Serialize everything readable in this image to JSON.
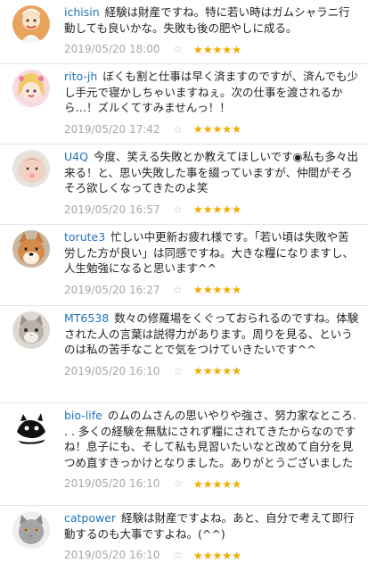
{
  "star_outline_glyph": "☆",
  "stars": "★★★★★",
  "colors": {
    "username": "#1f74bd",
    "date": "#a7a7a7",
    "stars": "#f0ad00",
    "divider": "#e4e4e4"
  },
  "comments": [
    {
      "user": "ichisin",
      "text": "経験は財産ですね。特に若い時はガムシャラニ行動しても良いかな。失敗も後の肥やしに成る。",
      "date": "2019/05/20 18:00"
    },
    {
      "user": "rito-jh",
      "text": "ぼくも割と仕事は早く済ますのですが、済んでも少し手元で寝かしちゃいますねぇ。次の仕事を渡されるから…！ズルくてすみませんっ！！",
      "date": "2019/05/20 17:42"
    },
    {
      "user": "U4Q",
      "text": "今度、笑える失敗とか教えてほしいです◉私も多々出来る！と、思い失敗した事を綴っていますが、仲間がそろそろ欲しくなってきたのよ笑",
      "date": "2019/05/20 16:57"
    },
    {
      "user": "torute3",
      "text": "忙しい中更新お疲れ様です。「若い頃は失敗や苦労した方が良い」は同感ですね。大きな糧になりますし、人生勉強になると思います^^",
      "date": "2019/05/20 16:27"
    },
    {
      "user": "MT6538",
      "text": "数々の修羅場をくぐっておられるのですね。体験された人の言葉は説得力があります。周りを見る、というのは私の苦手なことで気をつけていきたいです^^",
      "date": "2019/05/20 16:10"
    },
    {
      "user": "bio-life",
      "text": "のムのムさんの思いやりや強さ、努力家なところ. . . 多くの経験を無駄にされず糧にされてきたからなのですね！息子にも、そして私も見習いたいなと改めて自分を見つめ直すきっかけとなりました。ありがとうございました",
      "date": "2019/05/20 16:10"
    },
    {
      "user": "catpower",
      "text": "経験は財産ですよね。あと、自分で考えて即行動するのも大事ですよね。(^^)",
      "date": "2019/05/20 16:10"
    }
  ]
}
